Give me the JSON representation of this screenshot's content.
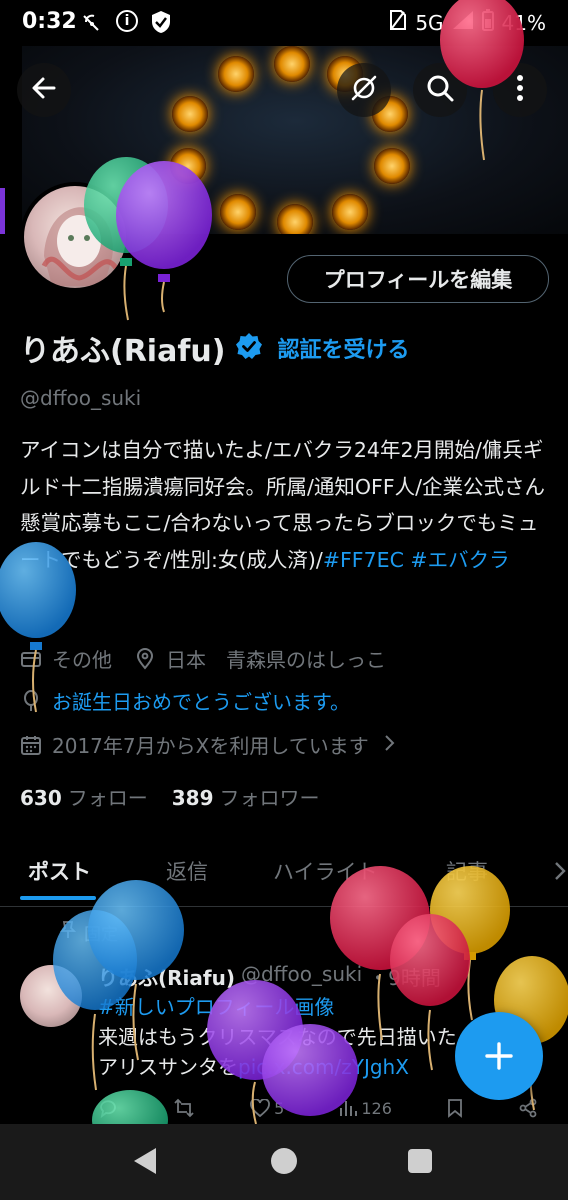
{
  "status_bar": {
    "time": "0:32",
    "network": "5G",
    "battery": "41%"
  },
  "profile": {
    "edit_button": "プロフィールを編集",
    "display_name": "りあふ(Riafu)",
    "verify_link": "認証を受ける",
    "handle": "@dffoo_suki",
    "bio_text": "アイコンは自分で描いたよ/エバクラ24年2月開始/傭兵ギルド十二指腸潰瘍同好会。所属/通知OFF人/企業公式さん懸賞応募もここ/合わないって思ったらブロックでもミュートでもどうぞ/性別:女(成人済)/",
    "bio_links": [
      "#FF7EC",
      "#エバクラ"
    ],
    "category": "その他",
    "location": "日本　青森県のはしっこ",
    "birthday": "お誕生日おめでとうございます。",
    "joined": "2017年7月からXを利用しています",
    "following_count": "630",
    "following_label": "フォロー",
    "followers_count": "389",
    "followers_label": "フォロワー"
  },
  "tabs": [
    "ポスト",
    "返信",
    "ハイライト",
    "記事"
  ],
  "post": {
    "pinned_label": "固定",
    "author": "りあふ(Riafu)",
    "handle": "@dffoo_suki",
    "time": "・9時間",
    "hashtag": "#新しいプロフィール画像",
    "line2": "来週はもうクリスマスなので先日描いた",
    "line3_prefix": "アリスサンタを",
    "line3_link": "pic.x.com/zYJghX",
    "likes": "5",
    "views": "126"
  },
  "colors": {
    "accent": "#1d9bf0",
    "background": "#000000",
    "muted": "#71767b"
  },
  "icons": [
    "back-icon",
    "no-sync-icon",
    "search-icon",
    "more-icon",
    "verified-icon",
    "category-icon",
    "location-icon",
    "birthday-icon",
    "calendar-icon",
    "chevron-right-icon",
    "pin-icon",
    "reply-icon",
    "repost-icon",
    "like-icon",
    "views-icon",
    "bookmark-icon",
    "share-icon",
    "plus-icon"
  ]
}
